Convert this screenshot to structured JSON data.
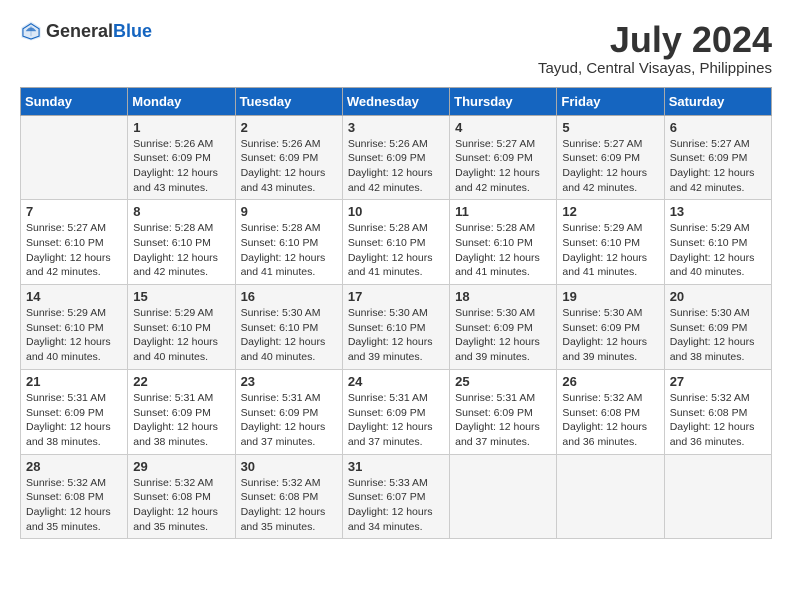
{
  "header": {
    "logo_general": "General",
    "logo_blue": "Blue",
    "month_year": "July 2024",
    "location": "Tayud, Central Visayas, Philippines"
  },
  "days_of_week": [
    "Sunday",
    "Monday",
    "Tuesday",
    "Wednesday",
    "Thursday",
    "Friday",
    "Saturday"
  ],
  "weeks": [
    [
      {
        "day": "",
        "sunrise": "",
        "sunset": "",
        "daylight": ""
      },
      {
        "day": "1",
        "sunrise": "Sunrise: 5:26 AM",
        "sunset": "Sunset: 6:09 PM",
        "daylight": "Daylight: 12 hours and 43 minutes."
      },
      {
        "day": "2",
        "sunrise": "Sunrise: 5:26 AM",
        "sunset": "Sunset: 6:09 PM",
        "daylight": "Daylight: 12 hours and 43 minutes."
      },
      {
        "day": "3",
        "sunrise": "Sunrise: 5:26 AM",
        "sunset": "Sunset: 6:09 PM",
        "daylight": "Daylight: 12 hours and 42 minutes."
      },
      {
        "day": "4",
        "sunrise": "Sunrise: 5:27 AM",
        "sunset": "Sunset: 6:09 PM",
        "daylight": "Daylight: 12 hours and 42 minutes."
      },
      {
        "day": "5",
        "sunrise": "Sunrise: 5:27 AM",
        "sunset": "Sunset: 6:09 PM",
        "daylight": "Daylight: 12 hours and 42 minutes."
      },
      {
        "day": "6",
        "sunrise": "Sunrise: 5:27 AM",
        "sunset": "Sunset: 6:09 PM",
        "daylight": "Daylight: 12 hours and 42 minutes."
      }
    ],
    [
      {
        "day": "7",
        "sunrise": "Sunrise: 5:27 AM",
        "sunset": "Sunset: 6:10 PM",
        "daylight": "Daylight: 12 hours and 42 minutes."
      },
      {
        "day": "8",
        "sunrise": "Sunrise: 5:28 AM",
        "sunset": "Sunset: 6:10 PM",
        "daylight": "Daylight: 12 hours and 42 minutes."
      },
      {
        "day": "9",
        "sunrise": "Sunrise: 5:28 AM",
        "sunset": "Sunset: 6:10 PM",
        "daylight": "Daylight: 12 hours and 41 minutes."
      },
      {
        "day": "10",
        "sunrise": "Sunrise: 5:28 AM",
        "sunset": "Sunset: 6:10 PM",
        "daylight": "Daylight: 12 hours and 41 minutes."
      },
      {
        "day": "11",
        "sunrise": "Sunrise: 5:28 AM",
        "sunset": "Sunset: 6:10 PM",
        "daylight": "Daylight: 12 hours and 41 minutes."
      },
      {
        "day": "12",
        "sunrise": "Sunrise: 5:29 AM",
        "sunset": "Sunset: 6:10 PM",
        "daylight": "Daylight: 12 hours and 41 minutes."
      },
      {
        "day": "13",
        "sunrise": "Sunrise: 5:29 AM",
        "sunset": "Sunset: 6:10 PM",
        "daylight": "Daylight: 12 hours and 40 minutes."
      }
    ],
    [
      {
        "day": "14",
        "sunrise": "Sunrise: 5:29 AM",
        "sunset": "Sunset: 6:10 PM",
        "daylight": "Daylight: 12 hours and 40 minutes."
      },
      {
        "day": "15",
        "sunrise": "Sunrise: 5:29 AM",
        "sunset": "Sunset: 6:10 PM",
        "daylight": "Daylight: 12 hours and 40 minutes."
      },
      {
        "day": "16",
        "sunrise": "Sunrise: 5:30 AM",
        "sunset": "Sunset: 6:10 PM",
        "daylight": "Daylight: 12 hours and 40 minutes."
      },
      {
        "day": "17",
        "sunrise": "Sunrise: 5:30 AM",
        "sunset": "Sunset: 6:10 PM",
        "daylight": "Daylight: 12 hours and 39 minutes."
      },
      {
        "day": "18",
        "sunrise": "Sunrise: 5:30 AM",
        "sunset": "Sunset: 6:09 PM",
        "daylight": "Daylight: 12 hours and 39 minutes."
      },
      {
        "day": "19",
        "sunrise": "Sunrise: 5:30 AM",
        "sunset": "Sunset: 6:09 PM",
        "daylight": "Daylight: 12 hours and 39 minutes."
      },
      {
        "day": "20",
        "sunrise": "Sunrise: 5:30 AM",
        "sunset": "Sunset: 6:09 PM",
        "daylight": "Daylight: 12 hours and 38 minutes."
      }
    ],
    [
      {
        "day": "21",
        "sunrise": "Sunrise: 5:31 AM",
        "sunset": "Sunset: 6:09 PM",
        "daylight": "Daylight: 12 hours and 38 minutes."
      },
      {
        "day": "22",
        "sunrise": "Sunrise: 5:31 AM",
        "sunset": "Sunset: 6:09 PM",
        "daylight": "Daylight: 12 hours and 38 minutes."
      },
      {
        "day": "23",
        "sunrise": "Sunrise: 5:31 AM",
        "sunset": "Sunset: 6:09 PM",
        "daylight": "Daylight: 12 hours and 37 minutes."
      },
      {
        "day": "24",
        "sunrise": "Sunrise: 5:31 AM",
        "sunset": "Sunset: 6:09 PM",
        "daylight": "Daylight: 12 hours and 37 minutes."
      },
      {
        "day": "25",
        "sunrise": "Sunrise: 5:31 AM",
        "sunset": "Sunset: 6:09 PM",
        "daylight": "Daylight: 12 hours and 37 minutes."
      },
      {
        "day": "26",
        "sunrise": "Sunrise: 5:32 AM",
        "sunset": "Sunset: 6:08 PM",
        "daylight": "Daylight: 12 hours and 36 minutes."
      },
      {
        "day": "27",
        "sunrise": "Sunrise: 5:32 AM",
        "sunset": "Sunset: 6:08 PM",
        "daylight": "Daylight: 12 hours and 36 minutes."
      }
    ],
    [
      {
        "day": "28",
        "sunrise": "Sunrise: 5:32 AM",
        "sunset": "Sunset: 6:08 PM",
        "daylight": "Daylight: 12 hours and 35 minutes."
      },
      {
        "day": "29",
        "sunrise": "Sunrise: 5:32 AM",
        "sunset": "Sunset: 6:08 PM",
        "daylight": "Daylight: 12 hours and 35 minutes."
      },
      {
        "day": "30",
        "sunrise": "Sunrise: 5:32 AM",
        "sunset": "Sunset: 6:08 PM",
        "daylight": "Daylight: 12 hours and 35 minutes."
      },
      {
        "day": "31",
        "sunrise": "Sunrise: 5:33 AM",
        "sunset": "Sunset: 6:07 PM",
        "daylight": "Daylight: 12 hours and 34 minutes."
      },
      {
        "day": "",
        "sunrise": "",
        "sunset": "",
        "daylight": ""
      },
      {
        "day": "",
        "sunrise": "",
        "sunset": "",
        "daylight": ""
      },
      {
        "day": "",
        "sunrise": "",
        "sunset": "",
        "daylight": ""
      }
    ]
  ]
}
